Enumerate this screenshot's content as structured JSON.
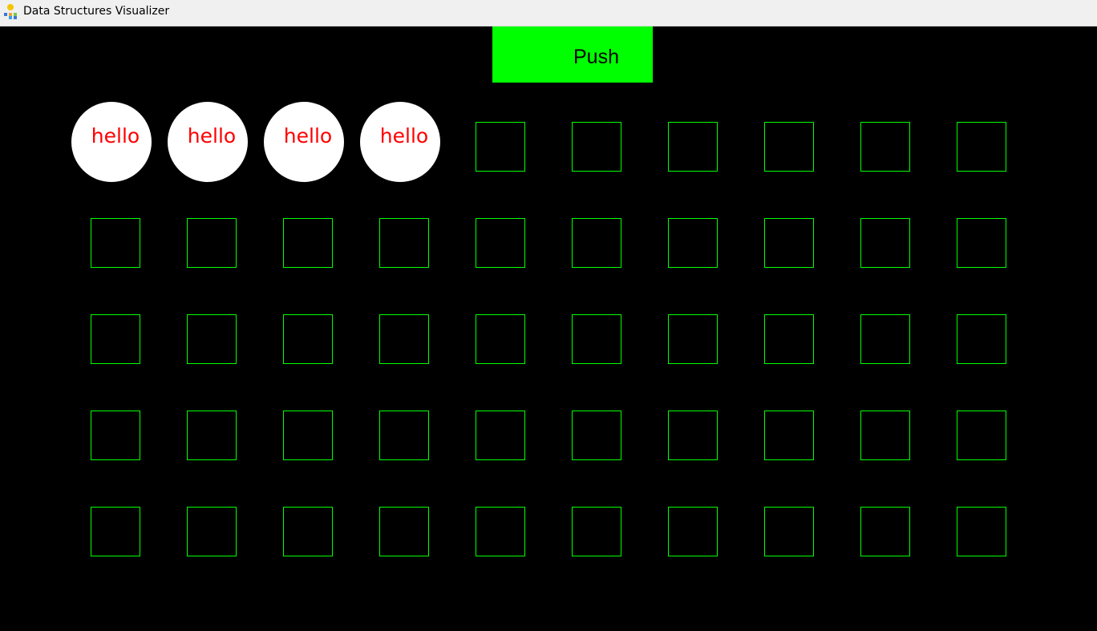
{
  "window": {
    "title": "Data Structures Visualizer",
    "icon": "app-icon"
  },
  "toolbar": {
    "push_label": "Push",
    "push_color": "#00ff00"
  },
  "stack": {
    "node_color": "#ffffff",
    "label_color": "#ff0000",
    "nodes": [
      {
        "label": "hello"
      },
      {
        "label": "hello"
      },
      {
        "label": "hello"
      },
      {
        "label": "hello"
      }
    ]
  },
  "grid": {
    "rows": 5,
    "columns": 10,
    "cell_border_color": "#00ff00",
    "background": "#000000"
  }
}
